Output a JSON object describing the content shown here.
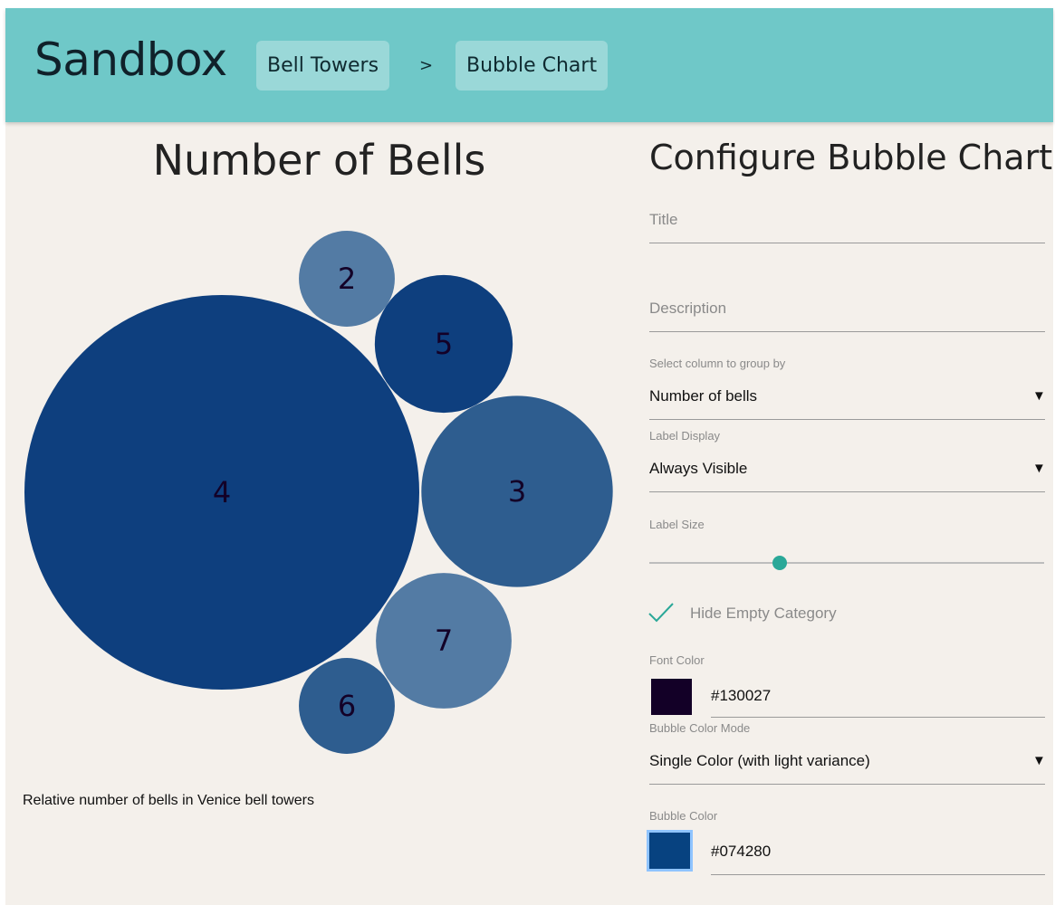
{
  "app": {
    "title": "Sandbox"
  },
  "breadcrumb": {
    "items": [
      "Bell Towers",
      "Bubble Chart"
    ],
    "separator": ">"
  },
  "chart": {
    "title": "Number of Bells",
    "description": "Relative number of bells in Venice bell towers"
  },
  "chart_data": {
    "type": "bubble",
    "title": "Number of Bells",
    "bubbles": [
      {
        "label": "4",
        "value": 100,
        "color": "#0e3f7e"
      },
      {
        "label": "3",
        "value": 23.5,
        "color": "#2e5d8f"
      },
      {
        "label": "5",
        "value": 12.2,
        "color": "#0e3f7e"
      },
      {
        "label": "7",
        "value": 11.8,
        "color": "#537ba4"
      },
      {
        "label": "2",
        "value": 5.9,
        "color": "#537ba4"
      },
      {
        "label": "6",
        "value": 5.9,
        "color": "#2e5d8f"
      }
    ],
    "label_color": "#130027"
  },
  "config": {
    "title": "Configure Bubble Chart",
    "title_placeholder": "Title",
    "description_placeholder": "Description",
    "group_by_label": "Select column to group by",
    "group_by_value": "Number of bells",
    "label_display_label": "Label Display",
    "label_display_value": "Always Visible",
    "label_size_label": "Label Size",
    "label_size_fraction": 0.33,
    "hide_empty_label": "Hide Empty Category",
    "hide_empty_checked": true,
    "font_color_label": "Font Color",
    "font_color_value": "#130027",
    "bubble_color_mode_label": "Bubble Color Mode",
    "bubble_color_mode_value": "Single Color (with light variance)",
    "bubble_color_label": "Bubble Color",
    "bubble_color_value": "#074280"
  },
  "colors": {
    "header": "#6fc8c8",
    "background": "#f4f0eb",
    "accent": "#2aa898"
  },
  "icons": {
    "dropdown": "caret-down-icon",
    "check": "check-icon"
  }
}
